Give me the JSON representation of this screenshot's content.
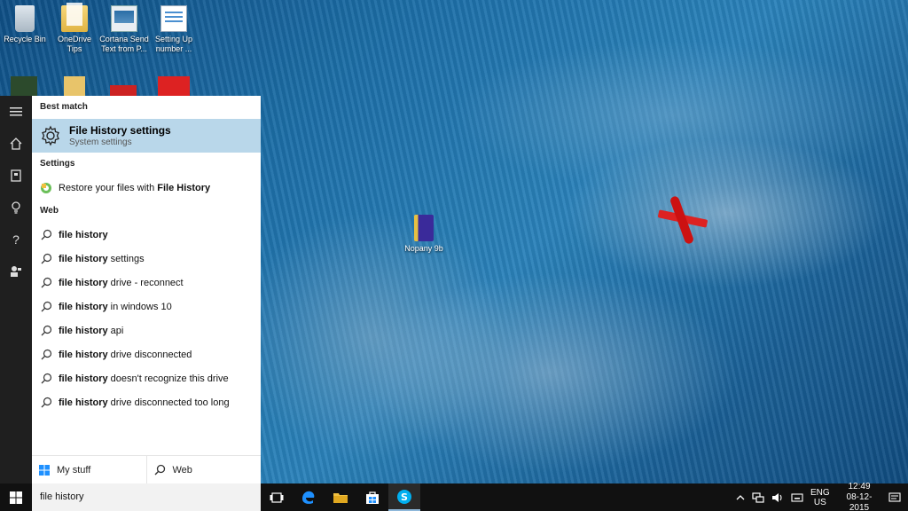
{
  "desktop": {
    "icons": [
      {
        "label": "Recycle Bin",
        "icon": "recycle-bin-icon"
      },
      {
        "label": "OneDrive Tips",
        "icon": "folder-icon"
      },
      {
        "label": "Cortana Send Text from P...",
        "icon": "screenshot-icon"
      },
      {
        "label": "Setting Up number ...",
        "icon": "document-icon"
      }
    ],
    "center_icon": {
      "label": "Nopany 9b",
      "icon": "book-icon"
    }
  },
  "search_panel": {
    "best_match_header": "Best match",
    "best_match": {
      "title": "File History settings",
      "subtitle": "System settings",
      "icon": "gear-icon"
    },
    "settings_header": "Settings",
    "settings_items": [
      {
        "prefix": "Restore your files with ",
        "bold": "File History",
        "icon": "file-history-icon"
      }
    ],
    "web_header": "Web",
    "web_items": [
      {
        "bold": "file history",
        "rest": ""
      },
      {
        "bold": "file history",
        "rest": " settings"
      },
      {
        "bold": "file history",
        "rest": " drive - reconnect"
      },
      {
        "bold": "file history",
        "rest": " in windows 10"
      },
      {
        "bold": "file history",
        "rest": " api"
      },
      {
        "bold": "file history",
        "rest": " drive disconnected"
      },
      {
        "bold": "file history",
        "rest": " doesn't recognize this drive"
      },
      {
        "bold": "file history",
        "rest": " drive disconnected too long"
      }
    ],
    "footer": {
      "my_stuff": "My stuff",
      "web": "Web"
    }
  },
  "rail": {
    "icons": [
      "hamburger-icon",
      "home-icon",
      "notebook-icon",
      "lightbulb-icon",
      "help-icon",
      "feedback-icon"
    ]
  },
  "taskbar": {
    "search_value": "file history",
    "apps": [
      "task-view-icon",
      "edge-icon",
      "file-explorer-icon",
      "store-icon",
      "skype-icon"
    ],
    "tray": {
      "lang_top": "ENG",
      "lang_bottom": "US",
      "time": "12:49",
      "date": "08-12-2015"
    }
  },
  "colors": {
    "selection": "#b9d7ea",
    "taskbar": "#111111",
    "rail": "#1f1f1f",
    "accent": "#1e90ff"
  }
}
